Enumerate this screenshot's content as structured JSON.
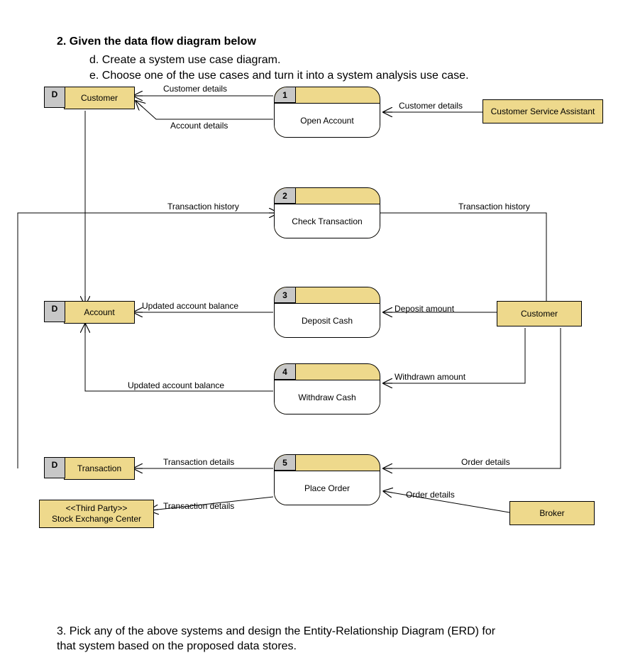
{
  "question2": {
    "heading": "2. Given the data flow diagram below",
    "item_d": "d.    Create a system use case diagram.",
    "item_e": "e.    Choose one of the use cases and turn it into a system analysis use case."
  },
  "question3": {
    "text_a": "3. Pick any of the above systems and design the Entity-Relationship Diagram (ERD) for",
    "text_b": "that system based on the proposed data stores."
  },
  "datastores": {
    "customer": {
      "tag": "D",
      "label": "Customer"
    },
    "account": {
      "tag": "D",
      "label": "Account"
    },
    "transaction": {
      "tag": "D",
      "label": "Transaction"
    }
  },
  "externals": {
    "csa": "Customer Service Assistant",
    "customer": "Customer",
    "broker": "Broker",
    "sec_stereo": "<<Third Party>>",
    "sec_name": "Stock Exchange Center"
  },
  "processes": {
    "p1": {
      "num": "1",
      "name": "Open Account"
    },
    "p2": {
      "num": "2",
      "name": "Check Transaction"
    },
    "p3": {
      "num": "3",
      "name": "Deposit Cash"
    },
    "p4": {
      "num": "4",
      "name": "Withdraw Cash"
    },
    "p5": {
      "num": "5",
      "name": "Place Order"
    }
  },
  "flows": {
    "f_cust_details_left": "Customer details",
    "f_acct_details": "Account details",
    "f_cust_details_right": "Customer details",
    "f_txn_hist_left": "Transaction history",
    "f_txn_hist_right": "Transaction history",
    "f_upd_bal_1": "Updated account balance",
    "f_deposit_amt": "Deposit amount",
    "f_upd_bal_2": "Updated account balance",
    "f_withdrawn_amt": "Withdrawn amount",
    "f_txn_details_store": "Transaction details",
    "f_order_details_broker": "Order details",
    "f_order_details_cust": "Order details",
    "f_txn_details_sec": "Transaction details"
  }
}
